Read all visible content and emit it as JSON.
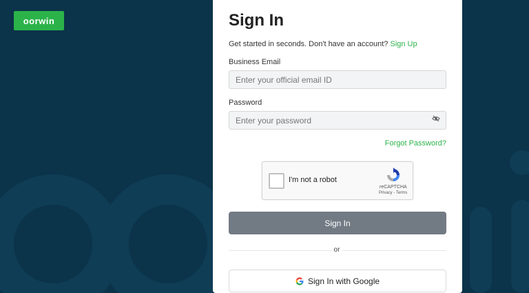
{
  "brand": {
    "logo_text": "oorwin",
    "color": "#2bb34a"
  },
  "form": {
    "title": "Sign In",
    "subtitle": "Get started in seconds. Don't have an account?",
    "signup_link": "Sign Up",
    "email": {
      "label": "Business Email",
      "placeholder": "Enter your official email ID",
      "value": ""
    },
    "password": {
      "label": "Password",
      "placeholder": "Enter your password",
      "value": "",
      "toggle_icon": "eye-off-icon"
    },
    "forgot_link": "Forgot Password?",
    "captcha": {
      "label": "I'm not a robot",
      "brand": "reCAPTCHA",
      "links": "Privacy - Terms",
      "checked": false
    },
    "submit_label": "Sign In",
    "divider_text": "or",
    "google_label": "Sign In with Google"
  },
  "colors": {
    "background": "#0b3349",
    "accent": "#2bb34a",
    "button": "#727a84"
  }
}
